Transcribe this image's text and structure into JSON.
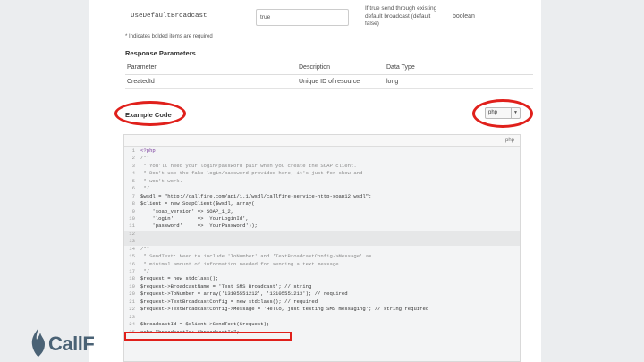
{
  "param": {
    "name": "UseDefaultBroadcast",
    "input_value": "true",
    "description": "If true send through existing default broadcast (default false)",
    "type": "boolean"
  },
  "required_note": "* Indicates bolded items are required",
  "response": {
    "title": "Response Parameters",
    "headers": [
      "Parameter",
      "Description",
      "Data Type"
    ],
    "rows": [
      [
        "CreatedId",
        "Unique ID of resource",
        "long"
      ]
    ]
  },
  "example": {
    "title": "Example Code",
    "language_selected": "php",
    "code_header_label": "php"
  },
  "code_lines": [
    {
      "n": "1",
      "text": "<?php"
    },
    {
      "n": "2",
      "text": "/**"
    },
    {
      "n": "3",
      "text": " * You'll need your login/password pair when you create the SOAP client."
    },
    {
      "n": "4",
      "text": " * Don't use the fake login/password provided here; it's just for show and"
    },
    {
      "n": "5",
      "text": " * won't work."
    },
    {
      "n": "6",
      "text": " */"
    },
    {
      "n": "7",
      "text": "$wsdl = \"http://callfire.com/api/1.1/wsdl/callfire-service-http-soap12.wsdl\";"
    },
    {
      "n": "8",
      "text": "$client = new SoapClient($wsdl, array("
    },
    {
      "n": "9",
      "text": "    'soap_version' => SOAP_1_2,"
    },
    {
      "n": "10",
      "text": "    'login'        => 'YourLoginId',"
    },
    {
      "n": "11",
      "text": "    'password'     => 'YourPassword'));"
    },
    {
      "n": "12",
      "text": ""
    },
    {
      "n": "13",
      "text": ""
    },
    {
      "n": "14",
      "text": "/**"
    },
    {
      "n": "15",
      "text": " * SendText: Need to include 'ToNumber' and 'TextBroadcastConfig->Message' as"
    },
    {
      "n": "16",
      "text": " * minimal amount of information needed for sending a text message."
    },
    {
      "n": "17",
      "text": " */"
    },
    {
      "n": "18",
      "text": "$request = new stdclass();"
    },
    {
      "n": "19",
      "text": "$request->BroadcastName = 'Test SMS Broadcast'; // string"
    },
    {
      "n": "20",
      "text": "$request->ToNumber = array('13105551212', '13105551213'); // required"
    },
    {
      "n": "21",
      "text": "$request->TextBroadcastConfig = new stdclass(); // required"
    },
    {
      "n": "22",
      "text": "$request->TextBroadcastConfig->Message = 'Hello, just testing SMS messaging'; // string required"
    },
    {
      "n": "23",
      "text": ""
    },
    {
      "n": "24",
      "text": "$broadcastId = $client->SendText($request);"
    },
    {
      "n": "25",
      "text": "echo \"broadcastId: $broadcastId\";"
    }
  ],
  "brand": {
    "name": "CallF",
    "accent_color": "#e0201b",
    "logo_color": "#4a6275",
    "logo_icon": "flame-icon"
  }
}
